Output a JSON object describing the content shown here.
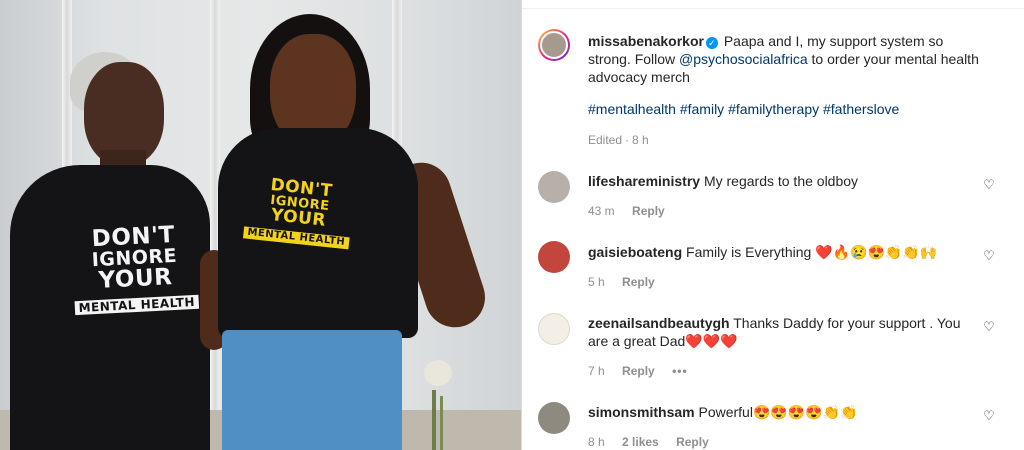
{
  "caption": {
    "username": "missabenakorkor",
    "text_before": " Paapa and I, my support system so strong. Follow ",
    "mention": "@psychosocialafrica",
    "text_after": " to order your mental health advocacy merch",
    "hashtags": "#mentalhealth #family #familytherapy #fatherslove",
    "edited": "Edited",
    "time": "8 h"
  },
  "photo": {
    "left_shirt": [
      "DON'T",
      "IGNORE",
      "YOUR",
      "MENTAL HEALTH"
    ],
    "right_shirt": [
      "DON'T",
      "IGNORE",
      "YOUR",
      "MENTAL HEALTH"
    ]
  },
  "comments": [
    {
      "username": "lifeshareministry",
      "text": "My regards to the oldboy",
      "time": "43 m",
      "reply": "Reply"
    },
    {
      "username": "gaisieboateng",
      "text": "Family is Everything ❤️🔥😢😍👏👏🙌",
      "time": "5 h",
      "reply": "Reply"
    },
    {
      "username": "zeenailsandbeautygh",
      "text": "Thanks Daddy for your support . You are a great Dad❤️❤️❤️",
      "time": "7 h",
      "reply": "Reply",
      "more": "•••"
    },
    {
      "username": "simonsmithsam",
      "text": "Powerful😍😍😍😍👏👏",
      "time": "8 h",
      "likes": "2 likes",
      "reply": "Reply"
    }
  ],
  "colors": {
    "link": "#00376b",
    "muted": "#8e8e8e",
    "verified": "#0095f6",
    "shirt_yellow": "#f2d21b"
  },
  "icons": {
    "heart": "heart-outline-icon",
    "verified": "verified-badge-icon",
    "more": "more-options-icon"
  }
}
